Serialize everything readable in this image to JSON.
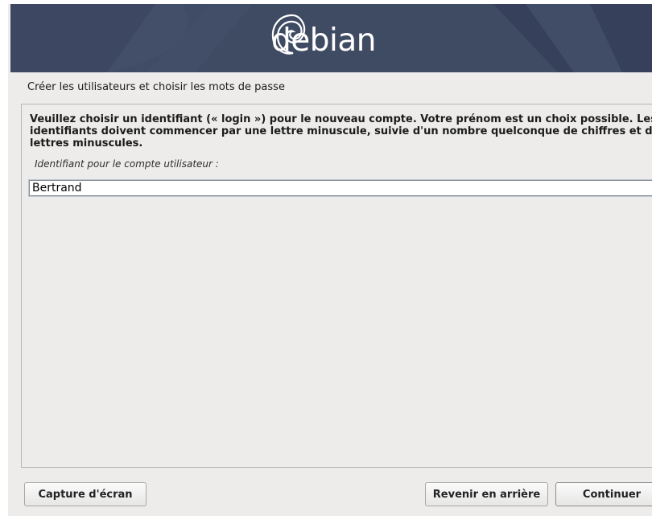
{
  "banner": {
    "brand": "debian"
  },
  "step": {
    "title": "Créer les utilisateurs et choisir les mots de passe"
  },
  "content": {
    "description": "Veuillez choisir un identifiant (« login ») pour le nouveau compte. Votre prénom est un choix possible. Les identifiants doivent commencer par une lettre minuscule, suivie d'un nombre quelconque de chiffres et de lettres minuscules.",
    "field_label": "Identifiant pour le compte utilisateur :",
    "field_value": "Bertrand"
  },
  "buttons": {
    "screenshot": "Capture d'écran",
    "back": "Revenir en arrière",
    "continue": "Continuer"
  },
  "colors": {
    "banner_bg": "#3f4a63",
    "window_bg": "#edeceb"
  },
  "icons": {
    "logo": "debian-swirl-icon"
  }
}
